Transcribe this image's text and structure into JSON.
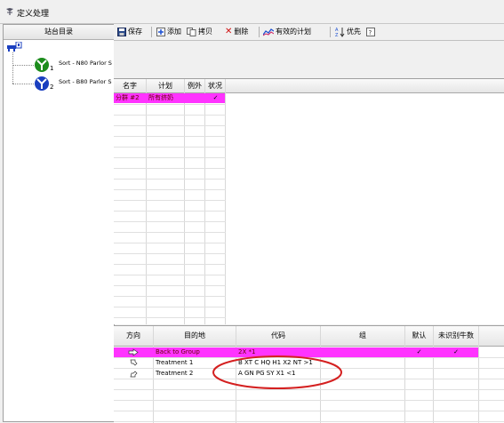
{
  "window": {
    "title": "定义处理"
  },
  "left_panel": {
    "header": "站台目录",
    "root_icon": "network-group-icon",
    "nodes": [
      {
        "label": "Sort - N80 Parlor S",
        "index": "1",
        "icon": "sort-gate-icon",
        "color": "#1c8c1c"
      },
      {
        "label": "Sort - B80 Parlor S",
        "index": "2",
        "icon": "sort-gate-icon",
        "color": "#1a3fbf"
      }
    ]
  },
  "toolbar": {
    "save": "保存",
    "add": "添加",
    "copy": "拷贝",
    "delete": "删除",
    "active_plan": "有效的计划",
    "priority": "优先",
    "help_icon": "help-icon"
  },
  "upper_table": {
    "headers": [
      "名字",
      "计划",
      "例外",
      "状况"
    ],
    "rows": [
      {
        "name": "分群 #2",
        "plan": "所有挤奶",
        "exception": "",
        "status": "✓",
        "highlight": "#ff33ff"
      }
    ]
  },
  "lower_table": {
    "headers": [
      "方向",
      "目的地",
      "代码",
      "组",
      "默认",
      "未识别牛数"
    ],
    "rows": [
      {
        "direction_icon": "arrow-right-icon",
        "destination": "Back to Group",
        "code": "2X *1",
        "group": "",
        "default": "✓",
        "unidentified": "✓",
        "highlight": "#ff33ff"
      },
      {
        "direction_icon": "arrow-diagonal-up-icon",
        "destination": "Treatment 1",
        "code": "B XT C HQ H1 X2 NT >1",
        "group": "",
        "default": "",
        "unidentified": ""
      },
      {
        "direction_icon": "arrow-diagonal-down-icon",
        "destination": "Treatment 2",
        "code": "A GN PG SY X1 <1",
        "group": "",
        "default": "",
        "unidentified": ""
      }
    ]
  },
  "colors": {
    "highlight_row": "#ff33ff",
    "annotation_circle": "#d42020"
  }
}
